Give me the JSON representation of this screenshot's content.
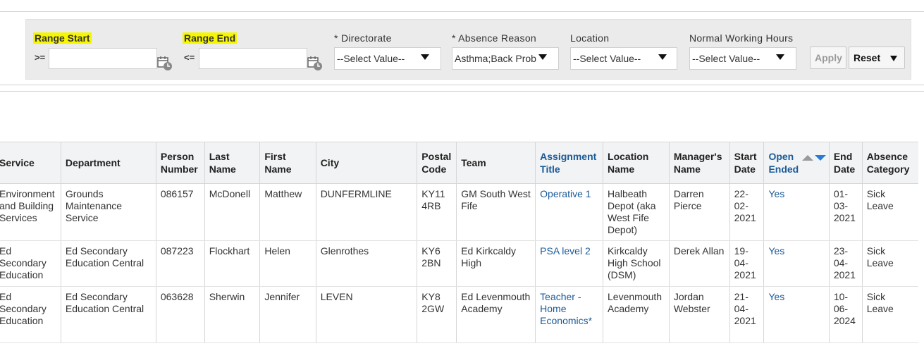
{
  "prompts": {
    "range_start": {
      "label": "Range Start",
      "operator": ">=",
      "value": ""
    },
    "range_end": {
      "label": "Range End",
      "operator": "<=",
      "value": ""
    },
    "directorate": {
      "label": "* Directorate",
      "value": "--Select Value--"
    },
    "absence_reason": {
      "label": "* Absence Reason",
      "value": "Asthma;Back Prob"
    },
    "location": {
      "label": "Location",
      "value": "--Select Value--"
    },
    "normal_working_hours": {
      "label": "Normal Working Hours",
      "value": "--Select Value--"
    },
    "apply_label": "Apply",
    "reset_label": "Reset"
  },
  "icons": {
    "calendar": "calendar-clock-icon",
    "dropdown": "triangle-down-icon"
  },
  "colors": {
    "highlight": "#f6f600",
    "link": "#1a5a98",
    "sort_active": "#2a7bd4",
    "sort_inactive": "#9a9a9a"
  },
  "table": {
    "columns": [
      "Service",
      "Department",
      "Person Number",
      "Last Name",
      "First Name",
      "City",
      "Postal Code",
      "Team",
      "Assignment Title",
      "Location Name",
      "Manager's Name",
      "Start Date",
      "Open Ended",
      "End Date",
      "Absence Category"
    ],
    "rows": [
      [
        "Environment and Building Services",
        "Grounds Maintenance Service",
        "086157",
        "McDonell",
        "Matthew",
        "DUNFERMLINE",
        "KY11 4RB",
        "GM South West Fife",
        "Operative 1",
        "Halbeath Depot (aka West Fife Depot)",
        "Darren Pierce",
        "22-02-2021",
        "Yes",
        "01-03-2021",
        "Sick Leave"
      ],
      [
        "Ed Secondary Education",
        "Ed Secondary Education Central",
        "087223",
        "Flockhart",
        "Helen",
        "Glenrothes",
        "KY6 2BN",
        "Ed Kirkcaldy High",
        "PSA level 2",
        "Kirkcaldy High School (DSM)",
        "Derek Allan",
        "19-04-2021",
        "Yes",
        "23-04-2021",
        "Sick Leave"
      ],
      [
        "Ed Secondary Education",
        "Ed Secondary Education Central",
        "063628",
        "Sherwin",
        "Jennifer",
        "LEVEN",
        "KY8 2GW",
        "Ed Levenmouth Academy",
        "Teacher - Home Economics*",
        "Levenmouth Academy",
        "Jordan Webster",
        "21-04-2021",
        "Yes",
        "10-06-2024",
        "Sick Leave"
      ]
    ]
  }
}
